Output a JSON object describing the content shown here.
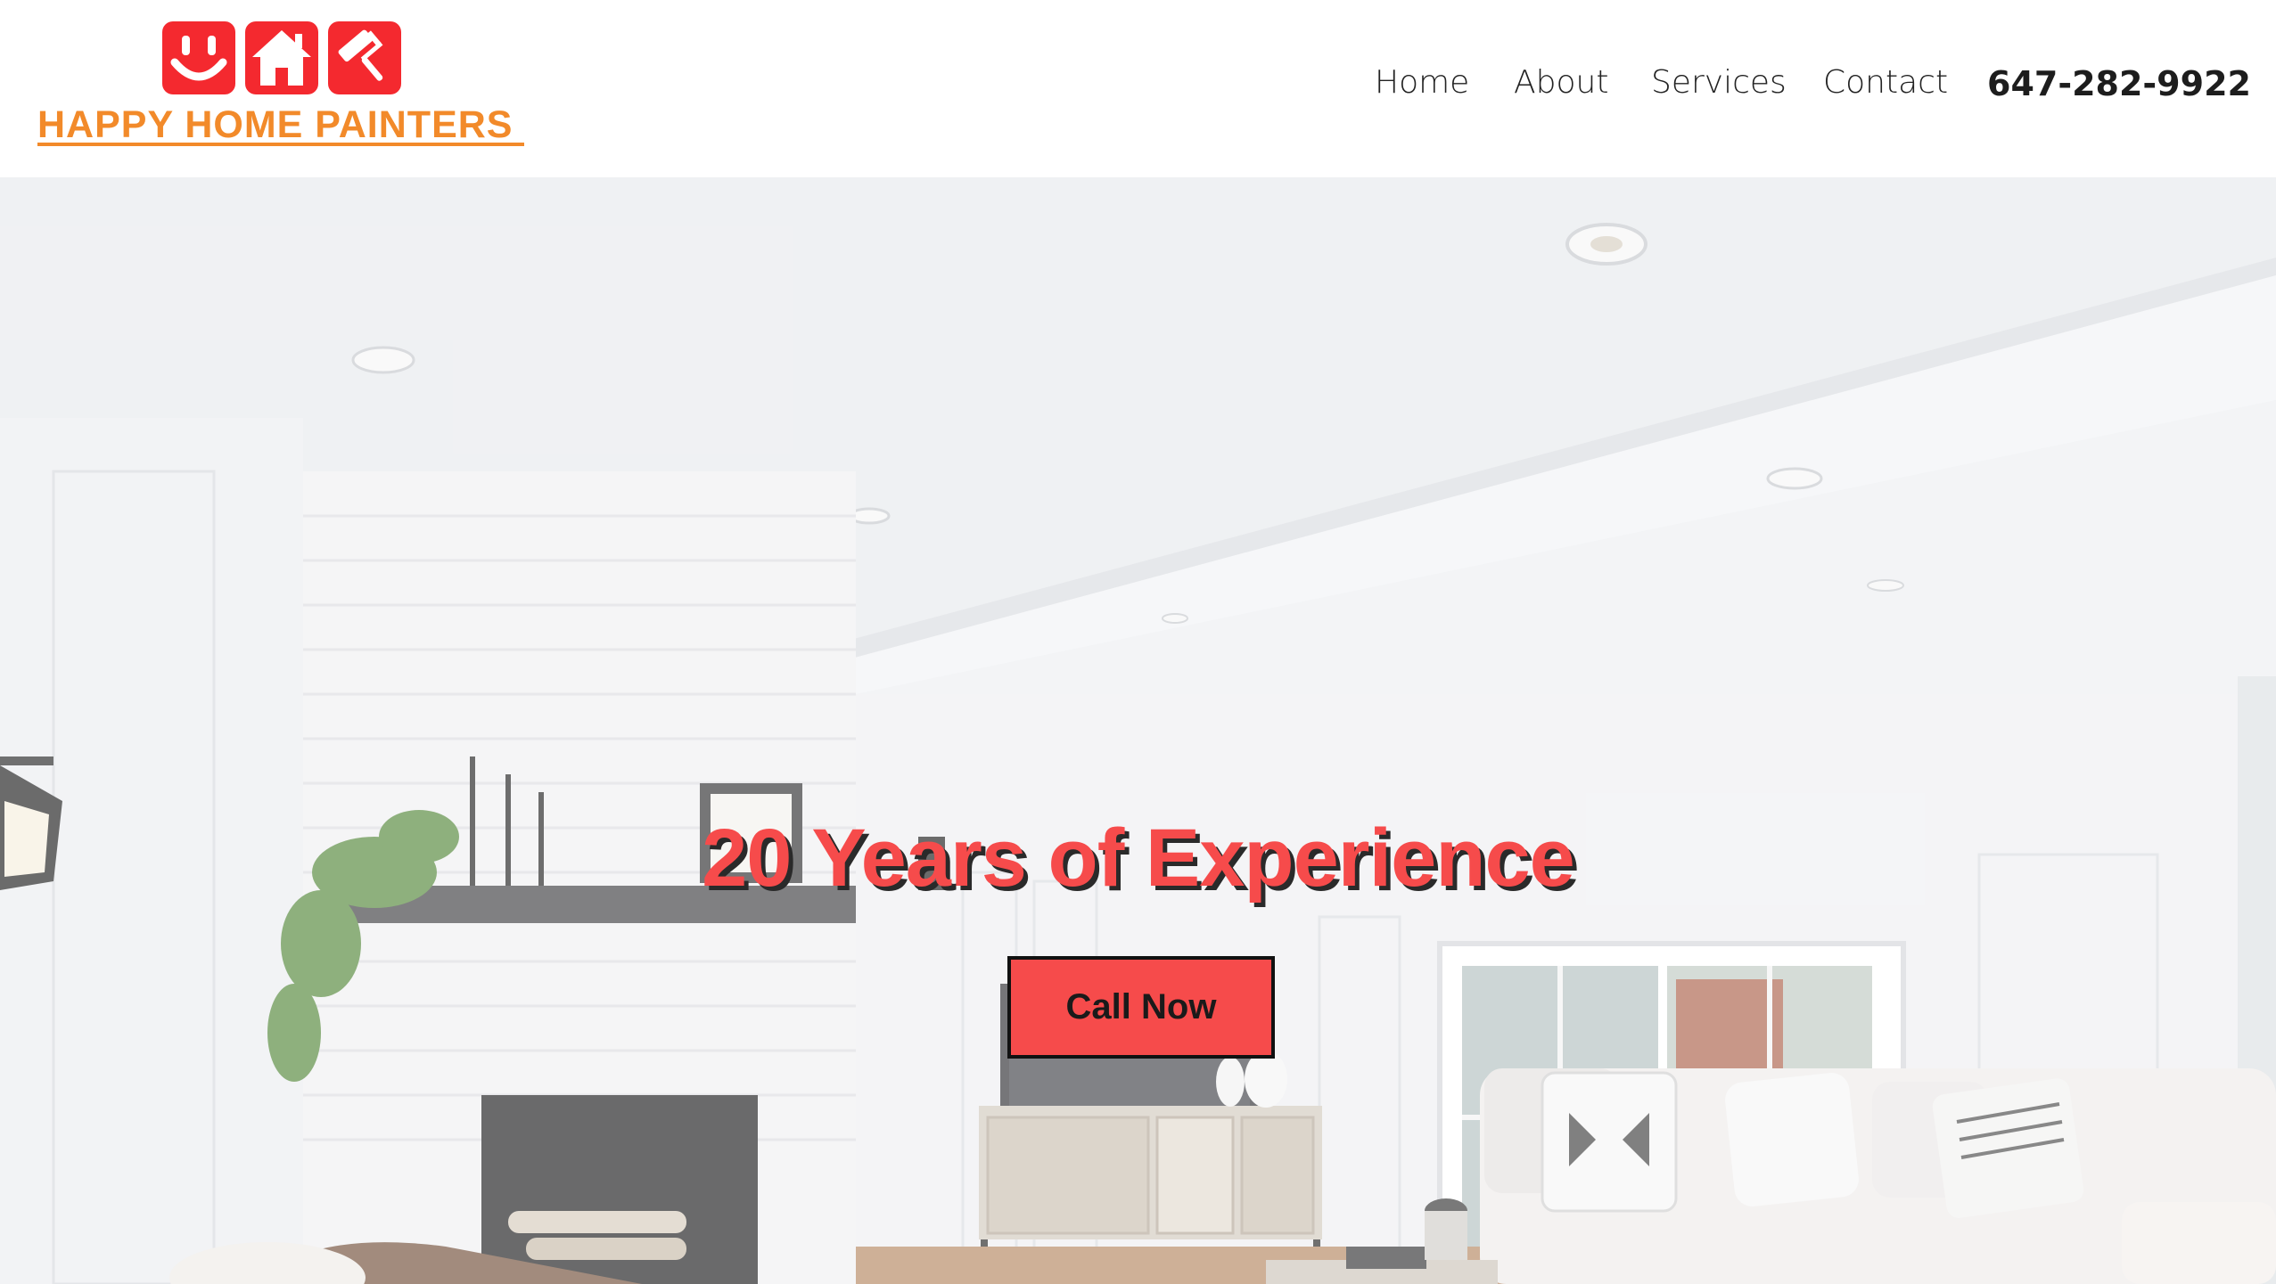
{
  "brand": {
    "name": "HAPPY HOME PAINTERS",
    "icons": [
      "smiley-face-icon",
      "house-icon",
      "paint-roller-icon"
    ],
    "icon_color": "#f4292f",
    "text_color": "#f28a2a"
  },
  "nav": {
    "items": [
      {
        "label": "Home"
      },
      {
        "label": "About"
      },
      {
        "label": "Services"
      },
      {
        "label": "Contact"
      }
    ],
    "phone": "647-282-9922"
  },
  "hero": {
    "title": "20 Years of Experience",
    "cta_label": "Call Now",
    "accent_color": "#f64b4b",
    "image_description_icon": "living-room-photo"
  }
}
